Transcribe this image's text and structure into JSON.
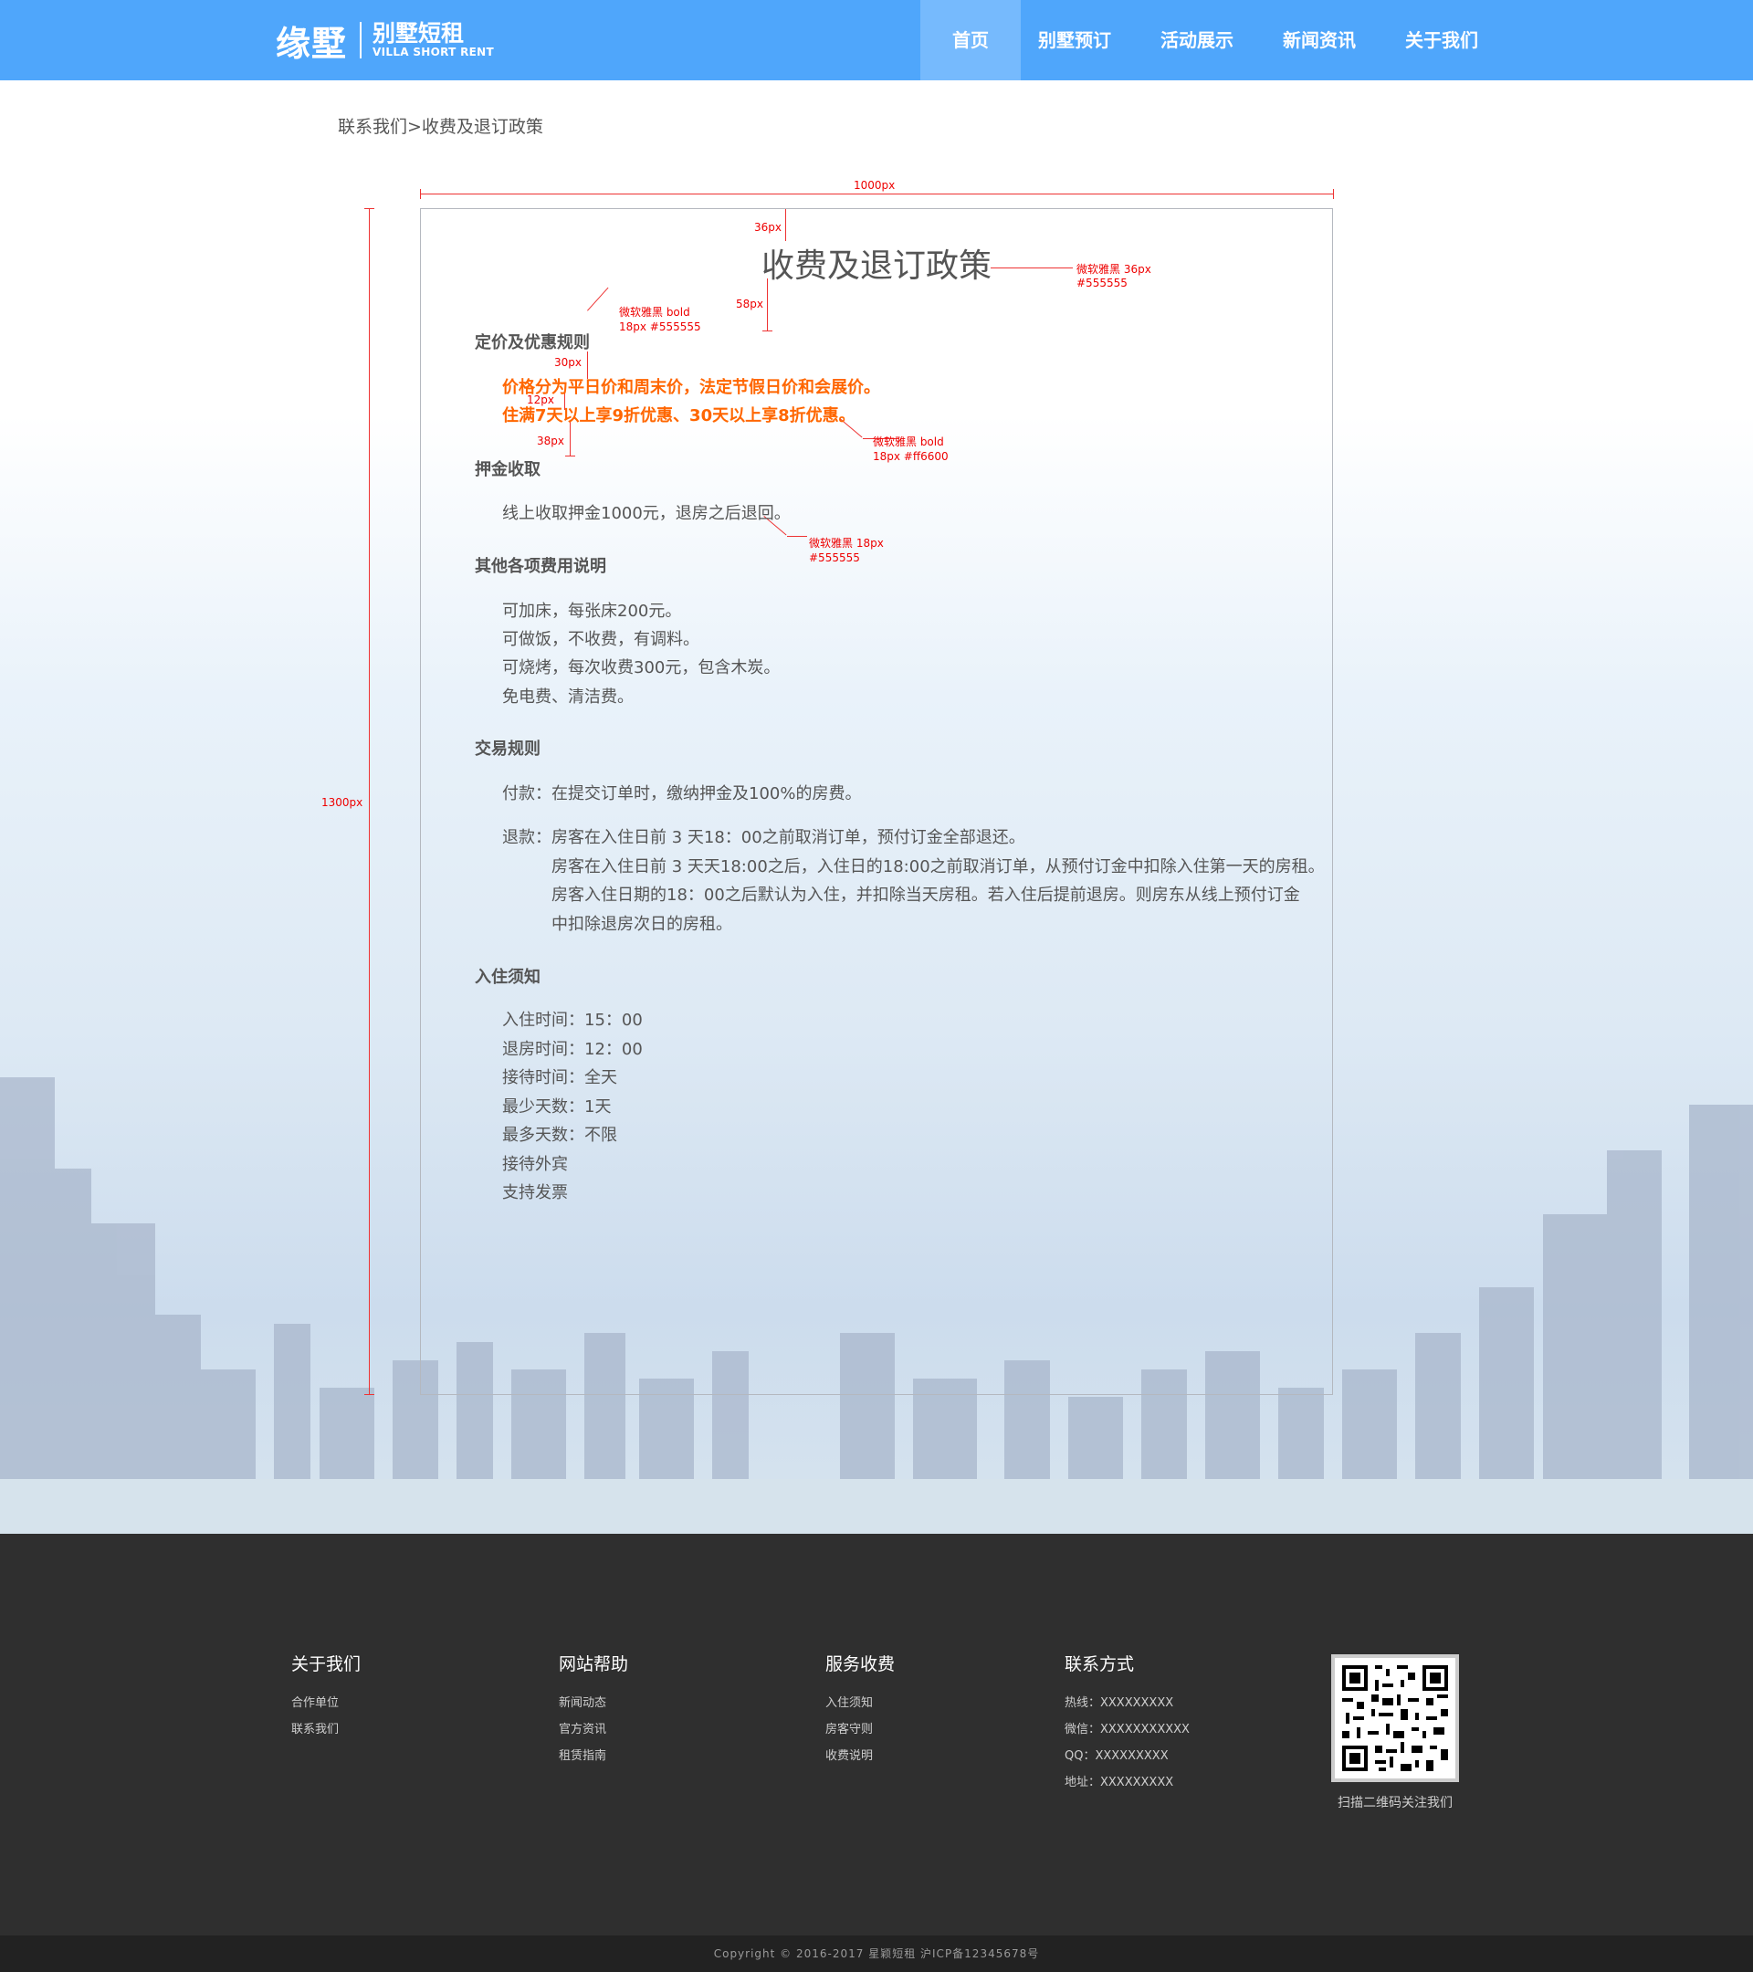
{
  "header": {
    "logo_cn": "缘墅",
    "logo_sub_cn": "别墅短租",
    "logo_sub_en": "VILLA SHORT RENT",
    "nav": [
      {
        "label": "首页",
        "active": true
      },
      {
        "label": "别墅预订"
      },
      {
        "label": "活动展示"
      },
      {
        "label": "新闻资讯"
      },
      {
        "label": "关于我们"
      }
    ]
  },
  "breadcrumb": "联系我们>收费及退订政策",
  "annotations": {
    "width_1000": "1000px",
    "height_1300": "1300px",
    "gap_36": "36px",
    "gap_58": "58px",
    "gap_30": "30px",
    "gap_12": "12px",
    "gap_38": "38px",
    "title_font": "微软雅黑   36px",
    "title_color": "#555555",
    "section_font": "微软雅黑  bold",
    "section_size": "18px  #555555",
    "orange_font": "微软雅黑  bold",
    "orange_size": "18px  #ff6600",
    "body_font": "微软雅黑 18px",
    "body_color": "#555555"
  },
  "content": {
    "title": "收费及退订政策",
    "pricing": {
      "heading": "定价及优惠规则",
      "lines": [
        "价格分为平日价和周末价，法定节假日价和会展价。",
        "住满7天以上享9折优惠、30天以上享8折优惠。"
      ]
    },
    "deposit": {
      "heading": "押金收取",
      "lines": [
        "线上收取押金1000元，退房之后退回。"
      ]
    },
    "other": {
      "heading": "其他各项费用说明",
      "lines": [
        "可加床，每张床200元。",
        "可做饭，不收费，有调料。",
        "可烧烤，每次收费300元，包含木炭。",
        "免电费、清洁费。"
      ]
    },
    "trade": {
      "heading": "交易规则",
      "pay": "付款：在提交订单时，缴纳押金及100%的房费。",
      "refund_first": "退款：房客在入住日前 3 天18：00之前取消订单，预付订金全部退还。",
      "refund_more": [
        "房客在入住日前 3 天天18:00之后，入住日的18:00之前取消订单，从预付订金中扣除入住第一天的房租。",
        "房客入住日期的18：00之后默认为入住，并扣除当天房租。若入住后提前退房。则房东从线上预付订金",
        "中扣除退房次日的房租。"
      ]
    },
    "checkin": {
      "heading": "入住须知",
      "lines": [
        "入住时间：15：00",
        "退房时间：12：00",
        "接待时间：全天",
        "最少天数：1天",
        "最多天数：不限",
        "接待外宾",
        "支持发票"
      ]
    }
  },
  "footer": {
    "cols": [
      {
        "title": "关于我们",
        "items": [
          "合作单位",
          "联系我们"
        ]
      },
      {
        "title": "网站帮助",
        "items": [
          "新闻动态",
          "官方资讯",
          "租赁指南"
        ]
      },
      {
        "title": "服务收费",
        "items": [
          "入住须知",
          "房客守则",
          "收费说明"
        ]
      },
      {
        "title": "联系方式",
        "items": [
          "热线：XXXXXXXXX",
          "微信：XXXXXXXXXXX",
          "QQ：XXXXXXXXX",
          "地址：XXXXXXXXX"
        ]
      }
    ],
    "qr_caption": "扫描二维码关注我们",
    "copyright": "Copyright © 2016-2017 星颖短租 沪ICP备12345678号"
  },
  "colors": {
    "header": "#4fa6fb",
    "nav_active": "#76bafd",
    "accent": "#ff6600",
    "text": "#555555",
    "footer": "#2f2f2f"
  }
}
